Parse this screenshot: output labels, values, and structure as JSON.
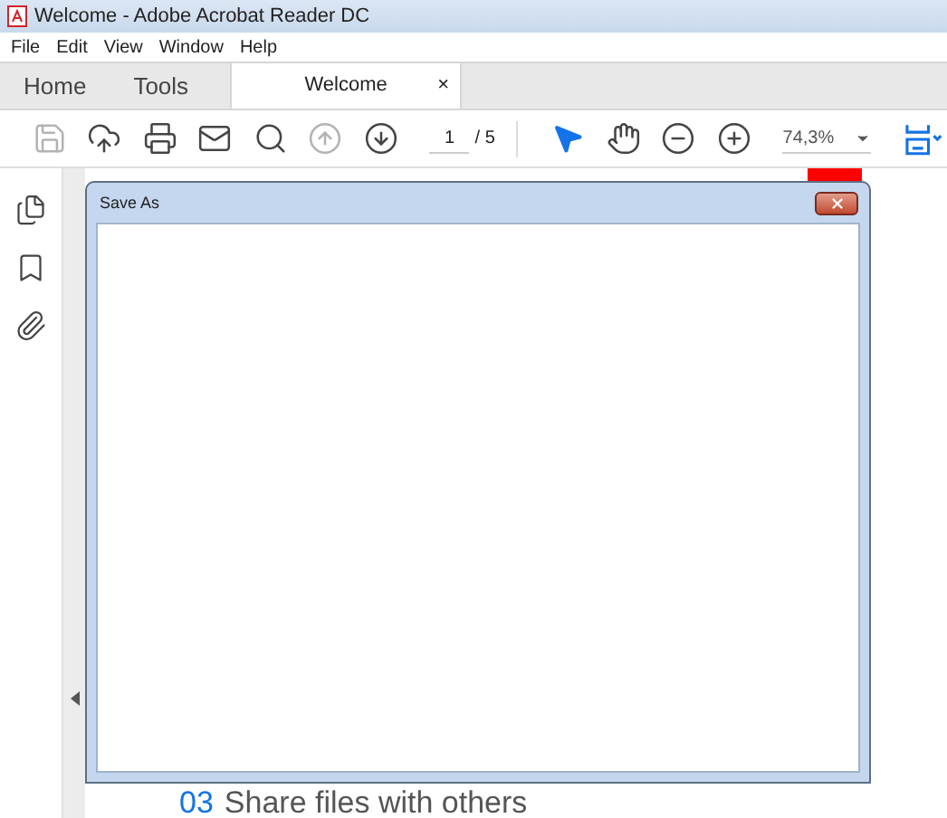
{
  "window": {
    "title": "Welcome - Adobe Acrobat Reader DC"
  },
  "menu": [
    "File",
    "Edit",
    "View",
    "Window",
    "Help"
  ],
  "tabs": [
    {
      "label": "Home",
      "selected": false
    },
    {
      "label": "Tools",
      "selected": false
    },
    {
      "label": "Welcome",
      "selected": true,
      "close": "×"
    }
  ],
  "toolbar": [
    {
      "kind": "save",
      "disabled": true
    },
    {
      "kind": "upload",
      "disabled": false
    },
    {
      "kind": "print",
      "disabled": false
    },
    {
      "kind": "mail",
      "disabled": false
    },
    {
      "kind": "search",
      "disabled": false
    },
    {
      "kind": "prev",
      "disabled": true
    },
    {
      "kind": "next",
      "disabled": false
    }
  ],
  "page": {
    "value": "1",
    "total": "/ 5"
  },
  "tools": [
    {
      "kind": "select",
      "selected": true
    },
    {
      "kind": "hand",
      "selected": false
    },
    {
      "kind": "zoom-out",
      "selected": false
    },
    {
      "kind": "zoom-in",
      "selected": false
    }
  ],
  "zoom": {
    "value": "74,3%"
  },
  "sidebar": [
    {
      "kind": "pages"
    },
    {
      "kind": "bookmark"
    },
    {
      "kind": "attachment"
    }
  ],
  "document": {
    "number": "03",
    "heading": "Share files with others"
  },
  "dialog": {
    "title": "Save As"
  }
}
